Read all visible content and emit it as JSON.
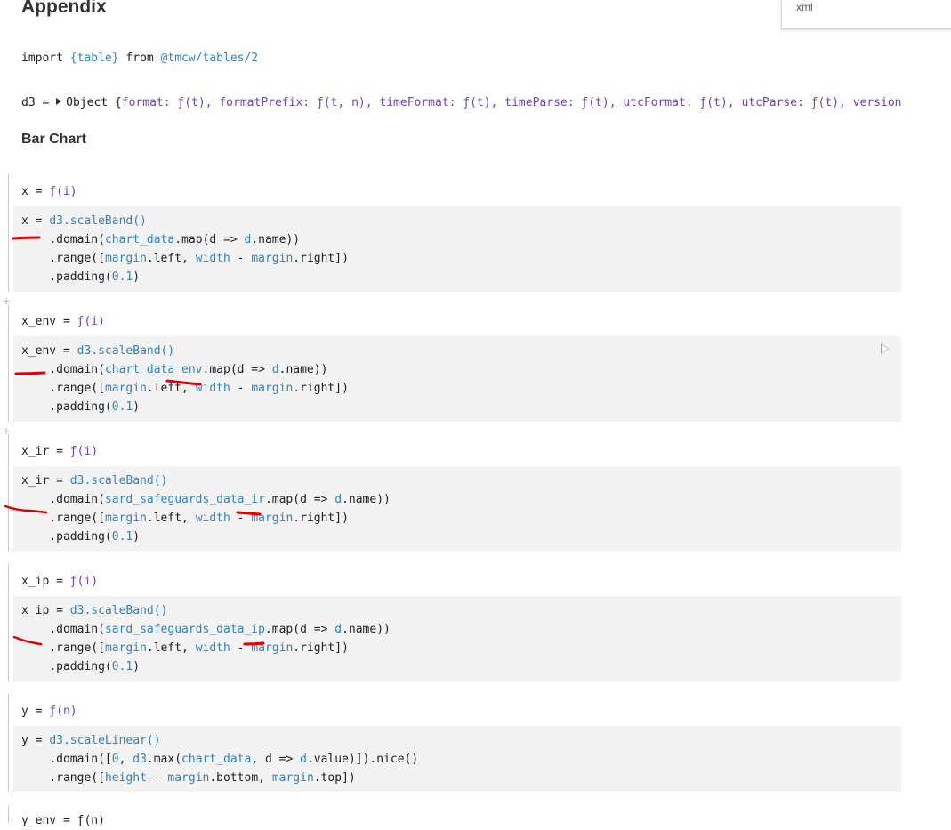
{
  "heading": "Appendix",
  "popup": {
    "label": "xml"
  },
  "import_line": {
    "kw_import": "import",
    "table": "{table}",
    "kw_from": "from",
    "source": "@tmcw/tables/2"
  },
  "d3_line": {
    "lhs": "d3 =",
    "object": "Object {",
    "format": "format:",
    "format_fn": "ƒ(t),",
    "formatPrefix": "formatPrefix:",
    "formatPrefix_fn": "ƒ(t, n),",
    "timeFormat": "timeFormat:",
    "timeFormat_fn": "ƒ(t),",
    "timeParse": "timeParse:",
    "timeParse_fn": "ƒ(t),",
    "utcFormat": "utcFormat:",
    "utcFormat_fn": "ƒ(t),",
    "utcParse": "utcParse:",
    "utcParse_fn": "ƒ(t),",
    "version": "version"
  },
  "section": "Bar Chart",
  "cells": [
    {
      "out_lhs": "x =",
      "out_fn": "ƒ(i)",
      "decl": "x",
      "scale": "d3.scaleBand()",
      "domain_pre": ".domain(",
      "domain_src": "chart_data",
      "domain_post": ".map(d => ",
      "domain_d": "d",
      "domain_end": ".name))",
      "range_pre": ".range([",
      "range_a": "margin",
      "range_b": ".left, ",
      "range_c": "width",
      "range_d": " - ",
      "range_e": "margin",
      "range_f": ".right])",
      "pad_pre": ".padding(",
      "pad_val": "0.1",
      "pad_end": ")"
    },
    {
      "out_lhs": "x_env =",
      "out_fn": "ƒ(i)",
      "decl": "x_env",
      "scale": "d3.scaleBand()",
      "domain_pre": ".domain(",
      "domain_src": "chart_data_env",
      "domain_post": ".map(d => ",
      "domain_d": "d",
      "domain_end": ".name))",
      "range_pre": ".range([",
      "range_a": "margin",
      "range_b": ".left, ",
      "range_c": "width",
      "range_d": " - ",
      "range_e": "margin",
      "range_f": ".right])",
      "pad_pre": ".padding(",
      "pad_val": "0.1",
      "pad_end": ")"
    },
    {
      "out_lhs": "x_ir =",
      "out_fn": "ƒ(i)",
      "decl": "x_ir",
      "scale": "d3.scaleBand()",
      "domain_pre": ".domain(",
      "domain_src": "sard_safeguards_data_ir",
      "domain_post": ".map(d => ",
      "domain_d": "d",
      "domain_end": ".name))",
      "range_pre": ".range([",
      "range_a": "margin",
      "range_b": ".left, ",
      "range_c": "width",
      "range_d": " - ",
      "range_e": "margin",
      "range_f": ".right])",
      "pad_pre": ".padding(",
      "pad_val": "0.1",
      "pad_end": ")"
    },
    {
      "out_lhs": "x_ip =",
      "out_fn": "ƒ(i)",
      "decl": "x_ip",
      "scale": "d3.scaleBand()",
      "domain_pre": ".domain(",
      "domain_src": "sard_safeguards_data_ip",
      "domain_post": ".map(d => ",
      "domain_d": "d",
      "domain_end": ".name))",
      "range_pre": ".range([",
      "range_a": "margin",
      "range_b": ".left, ",
      "range_c": "width",
      "range_d": " - ",
      "range_e": "margin",
      "range_f": ".right])",
      "pad_pre": ".padding(",
      "pad_val": "0.1",
      "pad_end": ")"
    }
  ],
  "y_cell": {
    "out_lhs": "y =",
    "out_fn": "ƒ(n)",
    "decl": "y",
    "scale": "d3.scaleLinear()",
    "domain_pre": ".domain([",
    "zero": "0",
    "comma": ", ",
    "max": "d3",
    "max_post": ".max(",
    "src": "chart_data",
    "arrow": ", d => ",
    "d": "d",
    "val": ".value)]).nice()",
    "range_pre": ".range([",
    "height": "height",
    "minus": " - ",
    "m1": "margin",
    "bottom": ".bottom, ",
    "m2": "margin",
    "top": ".top])"
  },
  "partial": "y_env = ƒ(n)",
  "annotation_color": "#e00000"
}
